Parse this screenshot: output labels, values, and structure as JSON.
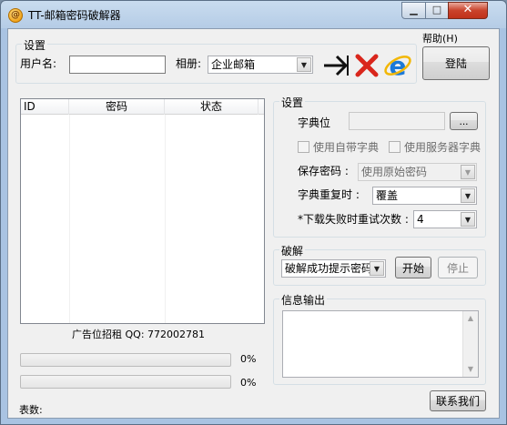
{
  "window": {
    "title": "TT-邮箱密码破解器",
    "controls": {
      "minimize": "▁",
      "maximize": "□",
      "close": "✕"
    }
  },
  "menu": {
    "help": "帮助(H)"
  },
  "settings_top": {
    "group_title": "设置",
    "username_label": "用户名:",
    "username_value": "",
    "album_label": "相册:",
    "album_value": "企业邮箱",
    "login_button": "登陆",
    "icons": [
      "arrow-right-icon",
      "red-x-icon",
      "ie-icon"
    ]
  },
  "list": {
    "columns": [
      "ID",
      "密码",
      "状态"
    ],
    "rows": [],
    "footer": "广告位招租  QQ: 772002781"
  },
  "progress": [
    {
      "value": 0,
      "label": "0%"
    },
    {
      "value": 0,
      "label": "0%"
    }
  ],
  "status": {
    "count_label": "表数:"
  },
  "settings_right": {
    "group_title": "设置",
    "dictionary_label": "字典位",
    "dictionary_value": "",
    "browse_button": "...",
    "use_builtin_dict": "使用自带字典",
    "use_server_dict": "使用服务器字典",
    "save_password_label": "保存密码 :",
    "save_password_value": "使用原始密码",
    "dict_repeat_label": "字典重复时 :",
    "dict_repeat_value": "覆盖",
    "retry_label": "*下载失败时重试次数 :",
    "retry_value": "4"
  },
  "crack": {
    "group_title": "破解",
    "mode_value": "破解成功提示密码",
    "start_button": "开始",
    "stop_button": "停止"
  },
  "output": {
    "group_title": "信息输出",
    "text": ""
  },
  "contact_button": "联系我们",
  "colors": {
    "progress_fill": "#06b025",
    "titlebar": "#b5cce6",
    "close_button": "#c9422b"
  }
}
